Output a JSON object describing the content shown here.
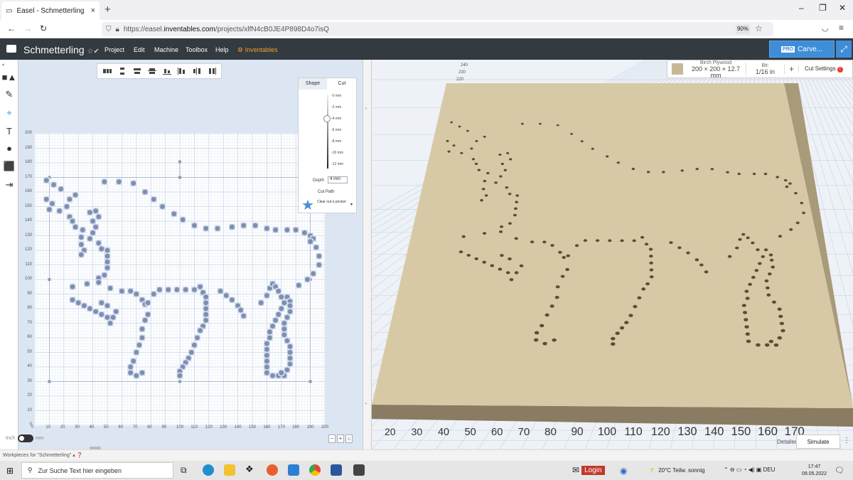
{
  "browser": {
    "tab_title": "Easel - Schmetterling",
    "tab_close": "×",
    "new_tab": "+",
    "url_prefix": "https://easel.",
    "url_domain": "inventables.com",
    "url_path": "/projects/xlfN4cB0JE4P898D4o7isQ",
    "zoom": "90%",
    "win_min": "–",
    "win_max": "❐",
    "win_close": "✕"
  },
  "app": {
    "title": "Schmetterling",
    "menu": [
      "Project",
      "Edit",
      "Machine",
      "Toolbox",
      "Help"
    ],
    "brand": "Inventables",
    "carve_pro": "PRO",
    "carve_label": "Carve..."
  },
  "design": {
    "y_ticks": [
      "200",
      "190",
      "180",
      "170",
      "160",
      "150",
      "140",
      "130",
      "120",
      "110",
      "100",
      "90",
      "80",
      "70",
      "60",
      "50",
      "40",
      "30",
      "20",
      "10",
      "0"
    ],
    "x_ticks": [
      "10",
      "20",
      "30",
      "40",
      "50",
      "60",
      "70",
      "80",
      "90",
      "100",
      "110",
      "120",
      "130",
      "140",
      "150",
      "160",
      "170",
      "180",
      "190",
      "200"
    ],
    "panel": {
      "tab_shape": "Shape",
      "tab_cut": "Cut",
      "depth_marks": [
        "-0 mm",
        "-2 mm",
        "-4 mm",
        "-6 mm",
        "-8 mm",
        "-10 mm",
        "-12 mm"
      ],
      "depth_label": "Depth",
      "depth_value": "4 mm",
      "cut_path_label": "Cut Path",
      "cut_path_value": "Clear out a pocket",
      "dropdown_arrow": "▾"
    },
    "unit_left": "Inch",
    "unit_right": "mm",
    "zoom_out": "−",
    "zoom_in": "+",
    "home": "⌂"
  },
  "preview": {
    "material_name": "Birch Plywood",
    "material_size": "200 × 200 × 12.7 mm",
    "bit_label": "Bit:",
    "bit_value": "1/16 in",
    "add": "+",
    "cut_settings": "Cut Settings",
    "cut_settings_warning": "!",
    "axis_labels": [
      "20",
      "30",
      "40",
      "50",
      "60",
      "70",
      "80",
      "90",
      "100",
      "110",
      "120",
      "130",
      "140",
      "150",
      "160",
      "170"
    ],
    "back_labels": [
      "240",
      "230",
      "220"
    ],
    "detailed": "Detailed",
    "simulate": "Simulate",
    "kebab": "⋮"
  },
  "workpieces": {
    "label": "Workpieces for \"Schmetterling\""
  },
  "taskbar": {
    "search_placeholder": "Zur Suche Text hier eingeben",
    "login": "Login",
    "weather": "20°C  Teilw. sonnig",
    "lang": "DEU",
    "time": "17:47",
    "date": "09.05.2022"
  },
  "colors": {
    "appbar": "#333a40",
    "carve": "#3e8dd9",
    "grid_bg": "#ffffff",
    "dot": "#7f8eaf",
    "wood": "#d8c9a6"
  },
  "holes": [
    [
      8,
      168
    ],
    [
      13,
      165
    ],
    [
      18,
      162
    ],
    [
      8,
      155
    ],
    [
      12,
      152
    ],
    [
      10,
      148
    ],
    [
      17,
      147
    ],
    [
      22,
      150
    ],
    [
      24,
      155
    ],
    [
      28,
      158
    ],
    [
      24,
      143
    ],
    [
      26,
      140
    ],
    [
      28,
      136
    ],
    [
      33,
      134
    ],
    [
      32,
      129
    ],
    [
      32,
      124
    ],
    [
      34,
      120
    ],
    [
      32,
      117
    ],
    [
      38,
      146
    ],
    [
      42,
      147
    ],
    [
      44,
      143
    ],
    [
      40,
      140
    ],
    [
      42,
      136
    ],
    [
      40,
      132
    ],
    [
      38,
      128
    ],
    [
      44,
      125
    ],
    [
      46,
      121
    ],
    [
      50,
      120
    ],
    [
      50,
      116
    ],
    [
      50,
      112
    ],
    [
      50,
      108
    ],
    [
      48,
      103
    ],
    [
      44,
      101
    ],
    [
      48,
      167
    ],
    [
      58,
      167
    ],
    [
      68,
      166
    ],
    [
      76,
      160
    ],
    [
      82,
      155
    ],
    [
      88,
      150
    ],
    [
      96,
      145
    ],
    [
      102,
      141
    ],
    [
      110,
      137
    ],
    [
      118,
      135
    ],
    [
      126,
      135
    ],
    [
      136,
      136
    ],
    [
      144,
      137
    ],
    [
      152,
      137
    ],
    [
      160,
      135
    ],
    [
      166,
      134
    ],
    [
      174,
      134
    ],
    [
      180,
      134
    ],
    [
      186,
      132
    ],
    [
      190,
      130
    ],
    [
      192,
      128
    ],
    [
      26,
      95
    ],
    [
      36,
      97
    ],
    [
      44,
      98
    ],
    [
      52,
      94
    ],
    [
      60,
      92
    ],
    [
      66,
      92
    ],
    [
      70,
      90
    ],
    [
      74,
      86
    ],
    [
      76,
      83
    ],
    [
      78,
      76
    ],
    [
      76,
      72
    ],
    [
      74,
      66
    ],
    [
      74,
      60
    ],
    [
      72,
      55
    ],
    [
      70,
      50
    ],
    [
      68,
      44
    ],
    [
      66,
      40
    ],
    [
      66,
      36
    ],
    [
      70,
      34
    ],
    [
      74,
      36
    ],
    [
      78,
      84
    ],
    [
      82,
      90
    ],
    [
      86,
      93
    ],
    [
      92,
      93
    ],
    [
      98,
      93
    ],
    [
      104,
      93
    ],
    [
      110,
      93
    ],
    [
      114,
      95
    ],
    [
      116,
      91
    ],
    [
      118,
      88
    ],
    [
      118,
      84
    ],
    [
      118,
      80
    ],
    [
      118,
      76
    ],
    [
      118,
      72
    ],
    [
      116,
      68
    ],
    [
      114,
      65
    ],
    [
      112,
      60
    ],
    [
      110,
      55
    ],
    [
      108,
      50
    ],
    [
      106,
      46
    ],
    [
      104,
      43
    ],
    [
      102,
      40
    ],
    [
      100,
      37
    ],
    [
      100,
      34
    ],
    [
      128,
      92
    ],
    [
      132,
      89
    ],
    [
      136,
      86
    ],
    [
      140,
      82
    ],
    [
      142,
      79
    ],
    [
      144,
      75
    ],
    [
      156,
      84
    ],
    [
      160,
      89
    ],
    [
      162,
      94
    ],
    [
      164,
      97
    ],
    [
      166,
      95
    ],
    [
      168,
      92
    ],
    [
      170,
      88
    ],
    [
      172,
      84
    ],
    [
      170,
      80
    ],
    [
      168,
      76
    ],
    [
      166,
      72
    ],
    [
      164,
      68
    ],
    [
      162,
      64
    ],
    [
      162,
      60
    ],
    [
      160,
      56
    ],
    [
      160,
      52
    ],
    [
      160,
      48
    ],
    [
      160,
      44
    ],
    [
      160,
      40
    ],
    [
      160,
      36
    ],
    [
      164,
      34
    ],
    [
      168,
      34
    ],
    [
      172,
      34
    ],
    [
      174,
      88
    ],
    [
      176,
      85
    ],
    [
      176,
      82
    ],
    [
      176,
      78
    ],
    [
      174,
      74
    ],
    [
      172,
      70
    ],
    [
      172,
      66
    ],
    [
      172,
      62
    ],
    [
      174,
      58
    ],
    [
      176,
      54
    ],
    [
      176,
      50
    ],
    [
      176,
      46
    ],
    [
      176,
      42
    ],
    [
      174,
      38
    ],
    [
      170,
      36
    ],
    [
      182,
      96
    ],
    [
      188,
      100
    ],
    [
      192,
      104
    ],
    [
      196,
      110
    ],
    [
      196,
      116
    ],
    [
      194,
      122
    ],
    [
      190,
      126
    ],
    [
      26,
      86
    ],
    [
      30,
      84
    ],
    [
      34,
      82
    ],
    [
      38,
      80
    ],
    [
      42,
      78
    ],
    [
      46,
      76
    ],
    [
      50,
      74
    ],
    [
      52,
      70
    ],
    [
      54,
      74
    ],
    [
      56,
      78
    ],
    [
      50,
      82
    ],
    [
      46,
      84
    ]
  ]
}
